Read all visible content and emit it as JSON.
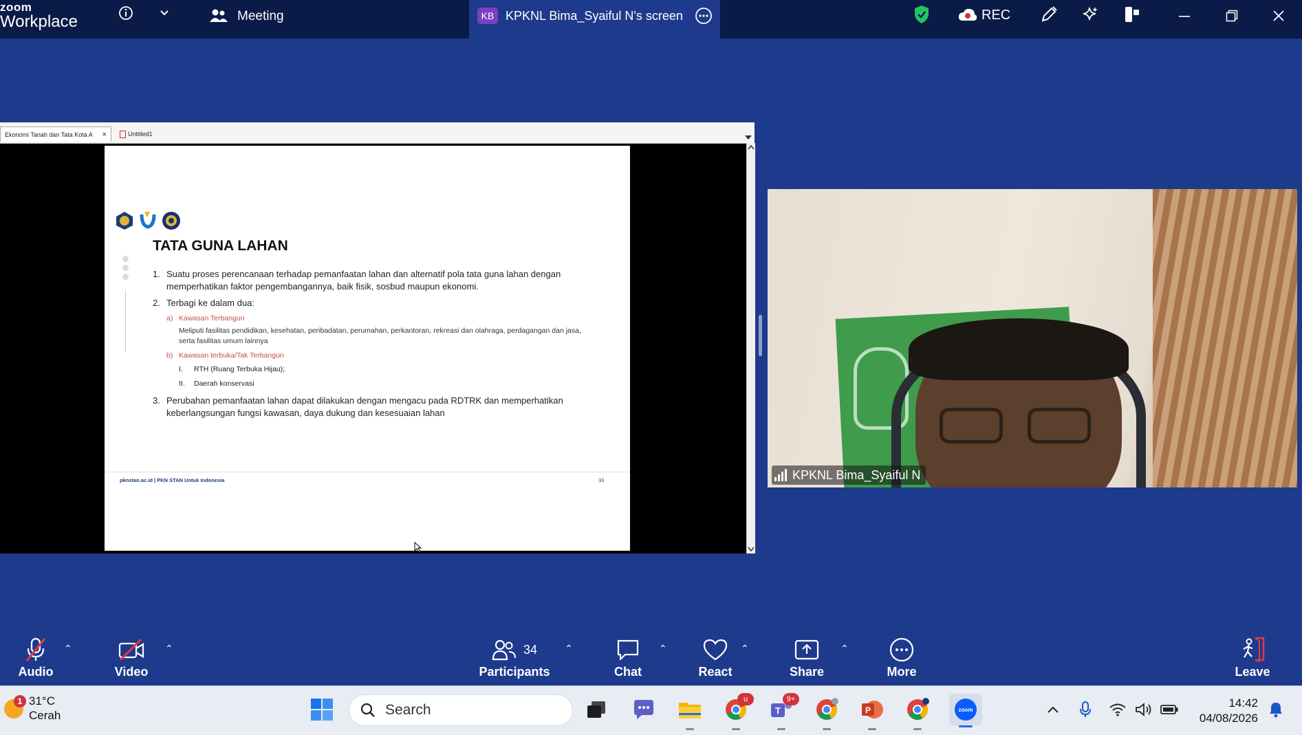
{
  "titlebar": {
    "logo_top": "zoom",
    "logo_bottom": "Workplace",
    "meeting_label": "Meeting",
    "share_badge": "KB",
    "share_title": "KPKNL Bima_Syaiful N's screen",
    "rec_label": "REC"
  },
  "shared_document": {
    "tabs": [
      "Ekonomi Tanah dan Tata Kota A",
      "Untitled1"
    ],
    "slide": {
      "title": "TATA GUNA LAHAN",
      "points": [
        {
          "num": "1.",
          "text": "Suatu proses perencanaan terhadap pemanfaatan lahan dan alternatif pola tata guna lahan dengan memperhatikan faktor pengembangannya, baik fisik, sosbud maupun ekonomi."
        },
        {
          "num": "2.",
          "text": "Terbagi ke dalam dua:"
        },
        {
          "num": "3.",
          "text": "Perubahan pemanfaatan lahan dapat dilakukan dengan mengacu pada RDTRK dan memperhatikan keberlangsungan fungsi kawasan, daya dukung dan kesesuaian lahan"
        }
      ],
      "sub_a": {
        "num": "a)",
        "label": "Kawasan Terbangun",
        "text": "Meliputi fasilitas pendidikan, kesehatan, peribadatan, perumahan, perkantoran, rekreasi dan olahraga, perdagangan dan jasa, serta fasilitas umum lainnya"
      },
      "sub_b": {
        "num": "b)",
        "label": "Kawasan terbuka/Tak Terbangun",
        "items": [
          {
            "num": "I.",
            "text": "RTH (Ruang Terbuka Hijau);"
          },
          {
            "num": "II.",
            "text": "Daerah konservasi"
          }
        ]
      },
      "footer_left": "pknstan.ac.id | PKN STAN Untuk Indonesia",
      "footer_right": "33"
    }
  },
  "participant_video": {
    "name": "KPKNL Bima_Syaiful N"
  },
  "toolbar": {
    "audio": "Audio",
    "video": "Video",
    "participants": "Participants",
    "participants_count": "34",
    "chat": "Chat",
    "react": "React",
    "share": "Share",
    "more": "More",
    "leave": "Leave"
  },
  "taskbar": {
    "weather_badge": "1",
    "temperature": "31°C",
    "condition": "Cerah",
    "search_placeholder": "Search",
    "chrome_badge_1": "u",
    "teams_badge": "9+",
    "clock_time": "14:42",
    "clock_date": "04/08/2026"
  },
  "colors": {
    "meeting_bg": "#1e3a8c",
    "titlebar_bg": "#0b1b47",
    "accent_red": "#d13438",
    "shield_green": "#22c55e",
    "slide_sub_red": "#c0504d"
  }
}
